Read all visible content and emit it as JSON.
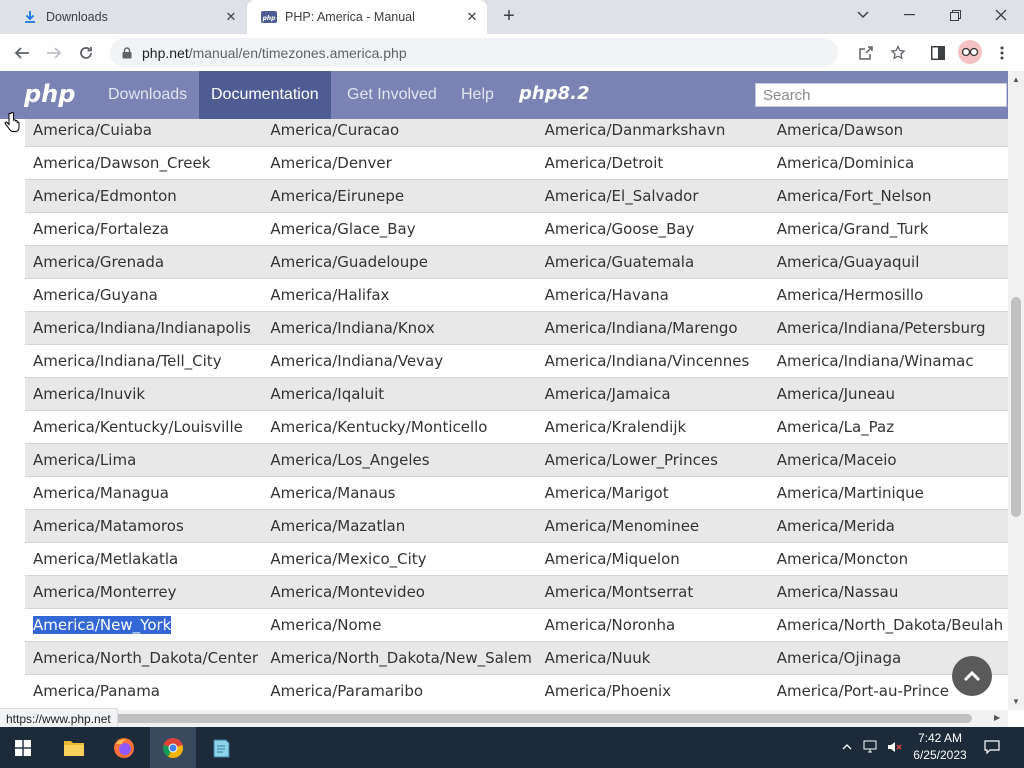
{
  "browser": {
    "tabs": [
      {
        "title": "Downloads",
        "active": false
      },
      {
        "title": "PHP: America - Manual",
        "active": true
      }
    ],
    "url_host": "php.net",
    "url_path": "/manual/en/timezones.america.php",
    "status_url": "https://www.php.net"
  },
  "php_nav": {
    "logo": "php",
    "items": [
      "Downloads",
      "Documentation",
      "Get Involved",
      "Help"
    ],
    "active_item": "Documentation",
    "promo": "php8.2",
    "search_placeholder": "Search"
  },
  "timezones": [
    [
      "America/Cuiaba",
      "America/Curacao",
      "America/Danmarkshavn",
      "America/Dawson"
    ],
    [
      "America/Dawson_Creek",
      "America/Denver",
      "America/Detroit",
      "America/Dominica"
    ],
    [
      "America/Edmonton",
      "America/Eirunepe",
      "America/El_Salvador",
      "America/Fort_Nelson"
    ],
    [
      "America/Fortaleza",
      "America/Glace_Bay",
      "America/Goose_Bay",
      "America/Grand_Turk"
    ],
    [
      "America/Grenada",
      "America/Guadeloupe",
      "America/Guatemala",
      "America/Guayaquil"
    ],
    [
      "America/Guyana",
      "America/Halifax",
      "America/Havana",
      "America/Hermosillo"
    ],
    [
      "America/Indiana/Indianapolis",
      "America/Indiana/Knox",
      "America/Indiana/Marengo",
      "America/Indiana/Petersburg"
    ],
    [
      "America/Indiana/Tell_City",
      "America/Indiana/Vevay",
      "America/Indiana/Vincennes",
      "America/Indiana/Winamac"
    ],
    [
      "America/Inuvik",
      "America/Iqaluit",
      "America/Jamaica",
      "America/Juneau"
    ],
    [
      "America/Kentucky/Louisville",
      "America/Kentucky/Monticello",
      "America/Kralendijk",
      "America/La_Paz"
    ],
    [
      "America/Lima",
      "America/Los_Angeles",
      "America/Lower_Princes",
      "America/Maceio"
    ],
    [
      "America/Managua",
      "America/Manaus",
      "America/Marigot",
      "America/Martinique"
    ],
    [
      "America/Matamoros",
      "America/Mazatlan",
      "America/Menominee",
      "America/Merida"
    ],
    [
      "America/Metlakatla",
      "America/Mexico_City",
      "America/Miquelon",
      "America/Moncton"
    ],
    [
      "America/Monterrey",
      "America/Montevideo",
      "America/Montserrat",
      "America/Nassau"
    ],
    [
      "America/New_York",
      "America/Nome",
      "America/Noronha",
      "America/North_Dakota/Beulah"
    ],
    [
      "America/North_Dakota/Center",
      "America/North_Dakota/New_Salem",
      "America/Nuuk",
      "America/Ojinaga"
    ],
    [
      "America/Panama",
      "America/Paramaribo",
      "America/Phoenix",
      "America/Port-au-Prince"
    ]
  ],
  "selected_timezone": "America/New_York",
  "taskbar": {
    "time": "7:42 AM",
    "date": "6/25/2023"
  },
  "colors": {
    "php_nav_bg": "#7b83b5",
    "php_nav_active": "#4f5b93",
    "selection": "#3367d6",
    "row_odd": "#e8e8e8"
  }
}
